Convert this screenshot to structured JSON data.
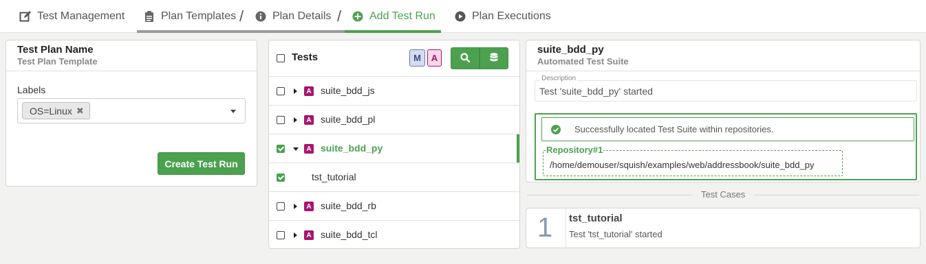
{
  "nav": {
    "test_management": "Test Management",
    "plan_templates": "Plan Templates",
    "sep1": "/",
    "plan_details": "Plan Details",
    "sep2": "/",
    "add_test_run": "Add Test Run",
    "plan_executions": "Plan Executions"
  },
  "left_panel": {
    "title": "Test Plan Name",
    "subtitle": "Test Plan Template",
    "labels_label": "Labels",
    "chip": "OS=Linux",
    "chip_remove": "✖",
    "create_button": "Create Test Run"
  },
  "tests_panel": {
    "header": "Tests",
    "badge_m": "M",
    "badge_a": "A",
    "rows": [
      {
        "label": "suite_bdd_js",
        "checked": false,
        "expanded": false,
        "badge": "A"
      },
      {
        "label": "suite_bdd_pl",
        "checked": false,
        "expanded": false,
        "badge": "A"
      },
      {
        "label": "suite_bdd_py",
        "checked": true,
        "expanded": true,
        "badge": "A"
      },
      {
        "label": "tst_tutorial",
        "checked": true,
        "expanded": false,
        "badge": ""
      },
      {
        "label": "suite_bdd_rb",
        "checked": false,
        "expanded": false,
        "badge": "A"
      },
      {
        "label": "suite_bdd_tcl",
        "checked": false,
        "expanded": false,
        "badge": "A"
      }
    ]
  },
  "suite_panel": {
    "title": "suite_bdd_py",
    "subtitle": "Automated Test Suite",
    "description_legend": "Description",
    "description": "Test 'suite_bdd_py' started",
    "success_message": "Successfully located Test Suite within repositories.",
    "repo_legend": "Repository#1",
    "repo_path": "/home/demouser/squish/examples/web/addressbook/suite_bdd_py"
  },
  "test_cases": {
    "heading": "Test Cases",
    "items": [
      {
        "number": "1",
        "name": "tst_tutorial",
        "description": "Test 'tst_tutorial' started"
      }
    ]
  },
  "colors": {
    "accent": "#4ca14f",
    "badge_a": "#a8146e",
    "badge_m_bg": "#d6dcf0",
    "badge_m_fg": "#3b4a8c"
  }
}
